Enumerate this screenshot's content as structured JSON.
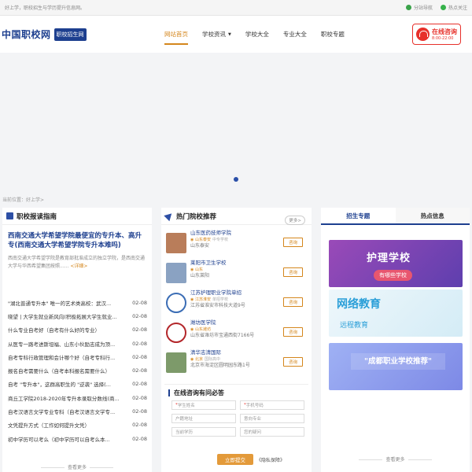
{
  "topbar": {
    "slogan": "好上学，职校招生与学历提升信息网。",
    "station_nav": "分站导航",
    "follow": "热点关注"
  },
  "header": {
    "logo_text": "中国职校网",
    "logo_badge": "职校招生网",
    "nav": [
      {
        "label": "网站首页",
        "active": true
      },
      {
        "label": "学校资讯",
        "dropdown": true
      },
      {
        "label": "学校大全"
      },
      {
        "label": "专业大全"
      },
      {
        "label": "职校专题"
      }
    ],
    "consult_title": "在线咨询",
    "consult_time": "8:00-22:00"
  },
  "breadcrumb": "当前位置：好上学>",
  "guide": {
    "title": "职校报读指南",
    "feature_title": "西南交通大学希望学院最便宜的专升本、高升专(西南交通大学希望学院专升本难吗)",
    "feature_desc": "西南交通大学希望学院是教育部批准成立的独立学院，是西南交通大学与华西希望集团按照......",
    "detail_link": "<详细>",
    "news": [
      {
        "title": "\"湖北普通专升本\" 唯一的艺术类高校：武汉...",
        "date": "02-08"
      },
      {
        "title": "晓望 | 大学生就业新风向(积极拓展大学生就业...",
        "date": "02-08"
      },
      {
        "title": "什么专业自考好（自考有什么好的专业）",
        "date": "02-08"
      },
      {
        "title": "从医专一路考进斯坦福、山东小伙励志成为顶...",
        "date": "02-08"
      },
      {
        "title": "自考专科行政管理和会计哪个好（自考专科行...",
        "date": "02-08"
      },
      {
        "title": "报名自考需要什么（自考本科报名需要什么）",
        "date": "02-08"
      },
      {
        "title": "自考 \"专升本\"，这群高职生的 \"逆袭\" 选择(...",
        "date": "02-08"
      },
      {
        "title": "商丘工学院2018-2020年专升本录取分数线(商...",
        "date": "02-08"
      },
      {
        "title": "自考汉语言文学专业专科（自考汉语言文学专...",
        "date": "02-08"
      },
      {
        "title": "文凭提升方式（工作如何提升文凭）",
        "date": "02-08"
      },
      {
        "title": "初中学历可以考么（初中学历可以自考么本...",
        "date": "02-08"
      }
    ],
    "more": "查看更多"
  },
  "hot": {
    "title": "热门院校推荐",
    "more": "更多>",
    "ask_label": "咨询",
    "schools": [
      {
        "name": "山东医药技师学院",
        "city": "山东泰安",
        "type": "中专学校",
        "addr": "山东泰安",
        "color": "#b97d5a"
      },
      {
        "name": "莱阳市卫生学校",
        "city": "山东",
        "type": "",
        "addr": "山东莱阳",
        "color": "#8aa2c2"
      },
      {
        "name": "江苏护理职业学院单招",
        "city": "江苏淮安",
        "type": "单招学校",
        "addr": "江苏省淮安市科技大道9号",
        "color": "#3b6db5"
      },
      {
        "name": "潍坊医学院",
        "city": "山东潍坊",
        "type": "",
        "addr": "山东省潍坊市宝通西街7166号",
        "color": "#b3262a"
      },
      {
        "name": "清华志清国际",
        "city": "北京",
        "type": "国际高中",
        "addr": "北京市海淀区圆明园东路1号",
        "color": "#7d9a6a"
      }
    ]
  },
  "form": {
    "title": "在线咨询有问必答",
    "fields": [
      {
        "ph": "学生姓名",
        "required": true
      },
      {
        "ph": "手机号码",
        "required": true
      },
      {
        "ph": "户籍地址",
        "required": false
      },
      {
        "ph": "意向专业",
        "required": false
      },
      {
        "ph": "当前学历",
        "required": false
      },
      {
        "ph": "您的疑问",
        "required": false
      }
    ],
    "submit": "立即提交",
    "privacy": "《隐私保障》"
  },
  "side": {
    "tabs": [
      {
        "label": "招生专题",
        "active": true
      },
      {
        "label": "热点信息"
      }
    ],
    "promo1_big": "护理学校",
    "promo1_sub": "有哪些学校",
    "promo2_big": "网络教育",
    "promo2_sub": "远程教育",
    "promo3_big": "\"成都职业学校推荐\"",
    "more": "查看更多"
  }
}
